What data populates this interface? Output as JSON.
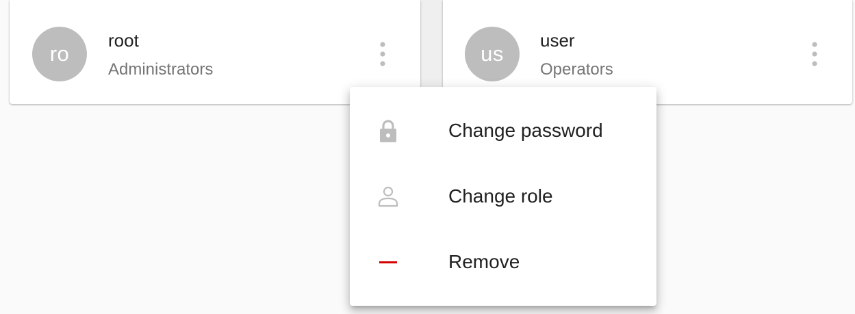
{
  "users": [
    {
      "initials": "ro",
      "name": "root",
      "role": "Administrators",
      "more_icon": "more-vert-icon"
    },
    {
      "initials": "us",
      "name": "user",
      "role": "Operators",
      "more_icon": "more-vert-icon"
    }
  ],
  "menu": {
    "items": [
      {
        "label": "Change password",
        "icon": "lock-icon"
      },
      {
        "label": "Change role",
        "icon": "person-icon"
      },
      {
        "label": "Remove",
        "icon": "remove-icon"
      }
    ]
  },
  "colors": {
    "background": "#fafafa",
    "card": "#ffffff",
    "avatar": "#bdbdbd",
    "secondary_text": "#757575",
    "icon_grey": "#bdbdbd",
    "danger": "#d50000"
  }
}
